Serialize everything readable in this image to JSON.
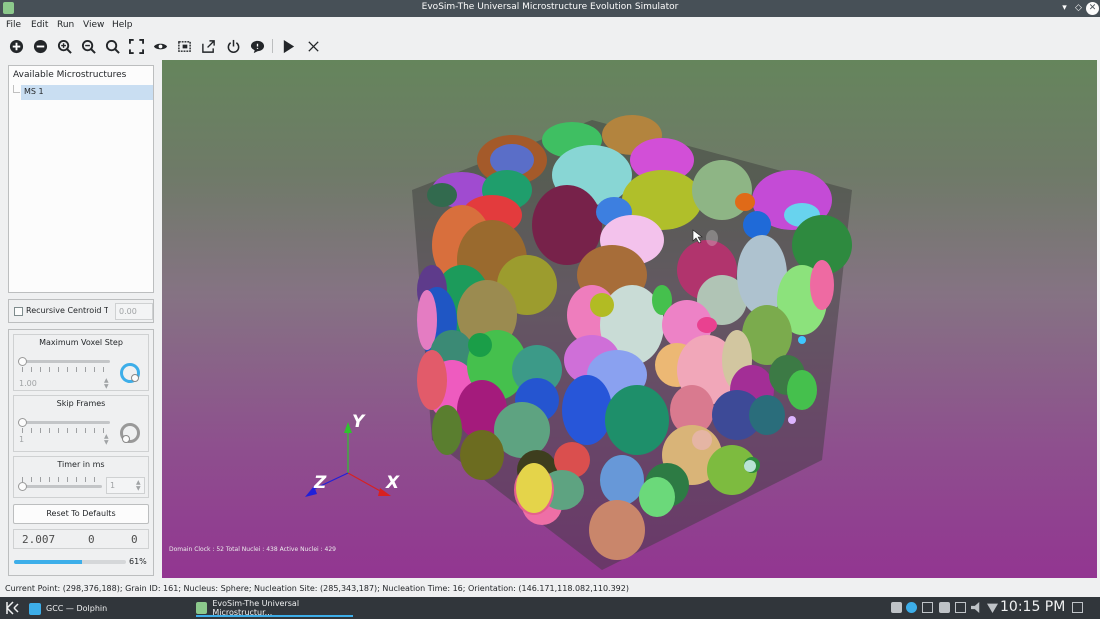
{
  "window": {
    "title": "EvoSim-The Universal Microstructure Evolution Simulator",
    "minimize_glyph": "▾",
    "maximize_glyph": "◇",
    "close_glyph": "✕"
  },
  "menu": {
    "file": "File",
    "edit": "Edit",
    "run": "Run",
    "view": "View",
    "help": "Help"
  },
  "toolbar": {
    "icons": [
      "add-icon",
      "remove-icon",
      "zoom-in-icon",
      "zoom-out-icon",
      "search-icon",
      "fit-view-icon",
      "eye-icon",
      "screenshot-icon",
      "export-icon",
      "power-icon",
      "comment-icon",
      "play-icon",
      "close-icon"
    ]
  },
  "sidebar": {
    "tree_header": "Available Microstructures",
    "tree_items": [
      "MS 1"
    ],
    "recursive_label": "Recursive Centroid T",
    "recursive_value": "0.00",
    "max_voxel": {
      "title": "Maximum Voxel Step",
      "value": "1.00"
    },
    "skip_frames": {
      "title": "Skip Frames",
      "value": "1"
    },
    "timer": {
      "title": "Timer in ms",
      "value": "1"
    },
    "reset_label": "Reset To Defaults",
    "lcd": [
      "2.007",
      "0",
      "0"
    ],
    "progress_percent": 61,
    "progress_text": "61%"
  },
  "viewport": {
    "hud": "Domain Clock : 52  Total Nuclei : 438  Active Nuclei : 429",
    "axes": {
      "y": "Y",
      "z": "Z",
      "x": "X"
    }
  },
  "status": {
    "text": "Current Point: (298,376,188); Grain ID: 161; Nucleus: Sphere; Nucleation Site: (285,343,187); Nucleation Time: 16; Orientation: (146.171,118.082,110.392)"
  },
  "taskbar": {
    "tasks": [
      "GCC — Dolphin",
      "EvoSim-The Universal Microstructur..."
    ],
    "clock": "10:15 PM"
  },
  "colors": {
    "accent": "#3daee9",
    "titlebar": "#475057",
    "taskbar": "#31363b",
    "viewport_top": "#65855c",
    "viewport_bottom": "#923591"
  }
}
